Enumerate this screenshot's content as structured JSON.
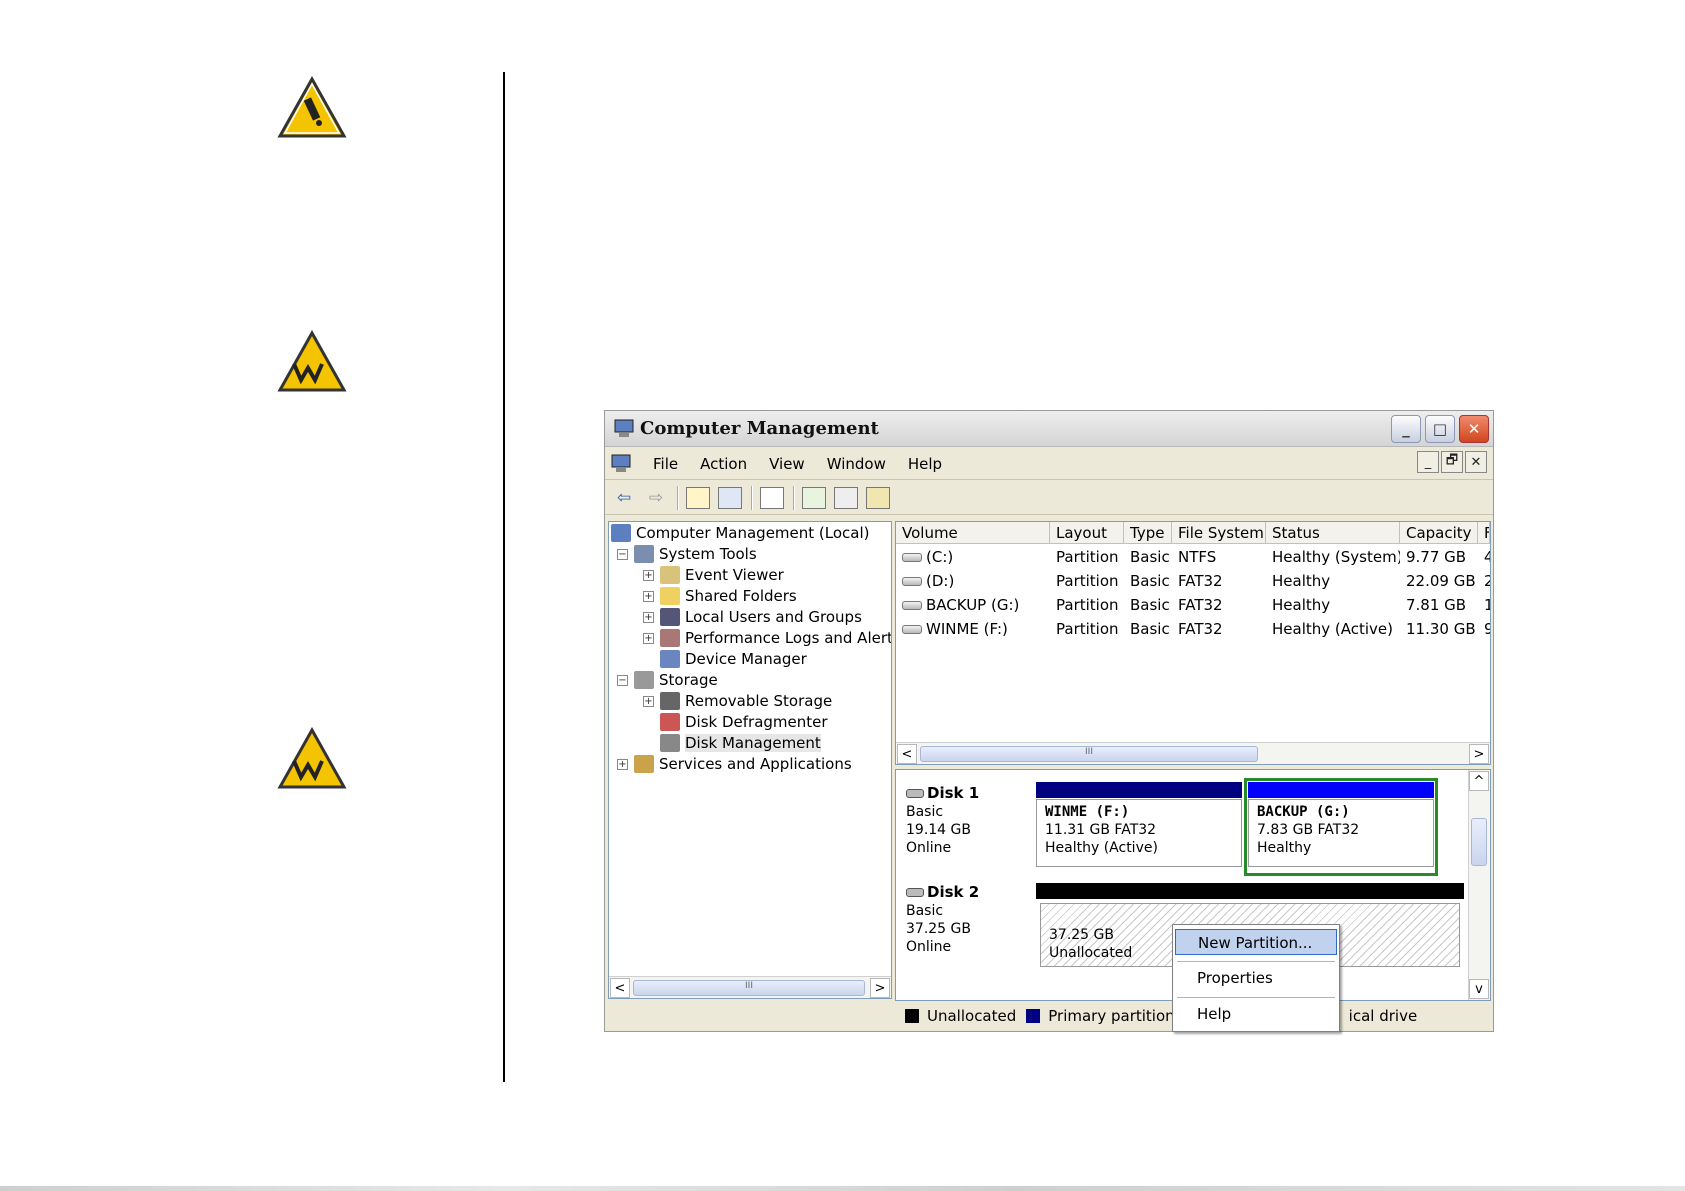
{
  "window": {
    "title": "Computer Management"
  },
  "title_buttons": [
    "_",
    "□",
    "✕"
  ],
  "menu": {
    "items": [
      "File",
      "Action",
      "View",
      "Window",
      "Help"
    ]
  },
  "mdi_buttons": [
    "_",
    "🗗",
    "✕"
  ],
  "tree": {
    "root": "Computer Management (Local)",
    "system_tools": "System Tools",
    "event_viewer": "Event Viewer",
    "shared_folders": "Shared Folders",
    "local_users": "Local Users and Groups",
    "perf_logs": "Performance Logs and Alerts",
    "device_manager": "Device Manager",
    "storage": "Storage",
    "removable_storage": "Removable Storage",
    "disk_defrag": "Disk Defragmenter",
    "disk_management": "Disk Management",
    "services": "Services and Applications",
    "expanded_glyph": "−",
    "collapsed_glyph": "+"
  },
  "list": {
    "columns": [
      "Volume",
      "Layout",
      "Type",
      "File System",
      "Status",
      "Capacity",
      "F"
    ],
    "rows": [
      {
        "volume": "(C:)",
        "layout": "Partition",
        "type": "Basic",
        "fs": "NTFS",
        "status": "Healthy (System)",
        "capacity": "9.77 GB",
        "free": "4"
      },
      {
        "volume": "(D:)",
        "layout": "Partition",
        "type": "Basic",
        "fs": "FAT32",
        "status": "Healthy",
        "capacity": "22.09 GB",
        "free": "2"
      },
      {
        "volume": "BACKUP (G:)",
        "layout": "Partition",
        "type": "Basic",
        "fs": "FAT32",
        "status": "Healthy",
        "capacity": "7.81 GB",
        "free": "1"
      },
      {
        "volume": "WINME (F:)",
        "layout": "Partition",
        "type": "Basic",
        "fs": "FAT32",
        "status": "Healthy (Active)",
        "capacity": "11.30 GB",
        "free": "9"
      }
    ]
  },
  "disks": [
    {
      "name": "Disk 1",
      "type": "Basic",
      "size": "19.14 GB",
      "state": "Online",
      "partitions": [
        {
          "name": "WINME  (F:)",
          "line2": "11.31 GB FAT32",
          "line3": "Healthy (Active)"
        },
        {
          "name": "BACKUP  (G:)",
          "line2": "7.83 GB FAT32",
          "line3": "Healthy"
        }
      ]
    },
    {
      "name": "Disk 2",
      "type": "Basic",
      "size": "37.25 GB",
      "state": "Online",
      "partitions": [
        {
          "name": "",
          "line2": "37.25 GB",
          "line3": "Unallocated"
        }
      ]
    }
  ],
  "legend": [
    "Unallocated",
    "Primary partition",
    "ical drive"
  ],
  "context_menu": [
    "New Partition...",
    "Properties",
    "Help"
  ],
  "scroll_grip": "III",
  "colors": {
    "primary_partition": "#000080",
    "selected_partition": "#0000ff",
    "selection_border": "#2a8a2a",
    "unallocated": "#000000",
    "legend_green": "#008000",
    "warning_yellow": "#f5c400"
  },
  "margin_icons": [
    "tech-note-icon",
    "warning-icon",
    "warning-icon"
  ]
}
